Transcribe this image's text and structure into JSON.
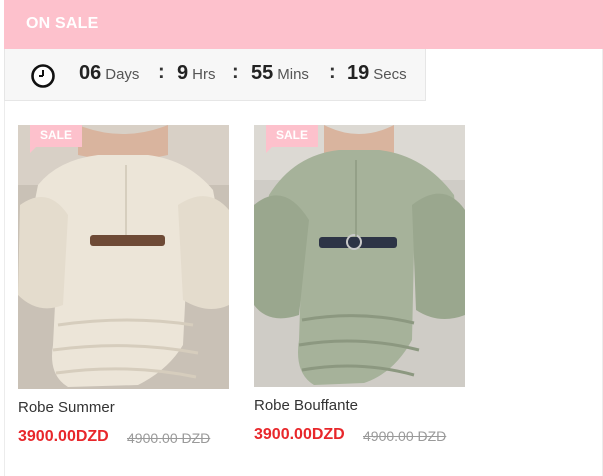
{
  "header": {
    "title": "ON SALE",
    "bg_color": "#fdc1cc"
  },
  "countdown": {
    "icon": "clock-icon",
    "days": {
      "value": "06",
      "label": "Days"
    },
    "hours": {
      "value": "9",
      "label": "Hrs"
    },
    "minutes": {
      "value": "55",
      "label": "Mins"
    },
    "seconds": {
      "value": "19",
      "label": "Secs"
    },
    "separator": ":"
  },
  "products": [
    {
      "badge": "SALE",
      "name": "Robe Summer",
      "price": "3900.00DZD",
      "old_price": "4900.00 DZD",
      "dress_color": "#ece5d8"
    },
    {
      "badge": "SALE",
      "name": "Robe Bouffante",
      "price": "3900.00DZD",
      "old_price": "4900.00 DZD",
      "dress_color": "#a6b29a"
    }
  ],
  "colors": {
    "price": "#e8272b",
    "old_price": "#9a9a9a",
    "badge": "#fdc1cc"
  }
}
